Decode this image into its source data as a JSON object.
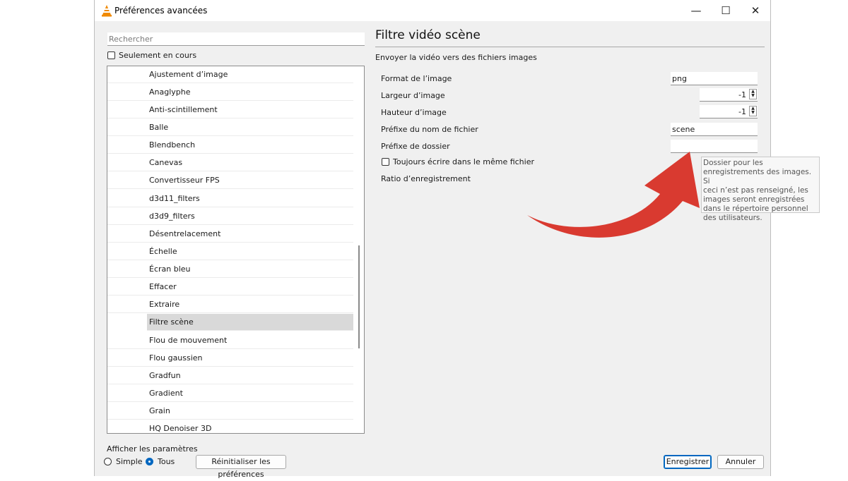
{
  "window": {
    "title": "Préférences avancées",
    "minimize": "—",
    "maximize": "☐",
    "close": "✕"
  },
  "search": {
    "placeholder": "Rechercher"
  },
  "filter": {
    "only_current_label": "Seulement en cours"
  },
  "tree": {
    "items": [
      "Ajustement d’image",
      "Anaglyphe",
      "Anti-scintillement",
      "Balle",
      "Blendbench",
      "Canevas",
      "Convertisseur FPS",
      "d3d11_filters",
      "d3d9_filters",
      "Désentrelacement",
      "Échelle",
      "Écran bleu",
      "Effacer",
      "Extraire",
      "Filtre scène",
      "Flou de mouvement",
      "Flou gaussien",
      "Gradfun",
      "Gradient",
      "Grain",
      "HQ Denoiser 3D"
    ],
    "selected": "Filtre scène"
  },
  "panel": {
    "title": "Filtre vidéo scène",
    "description": "Envoyer la vidéo vers des fichiers images",
    "format_label": "Format de l’image",
    "format_value": "png",
    "width_label": "Largeur d’image",
    "width_value": "-1",
    "height_label": "Hauteur d’image",
    "height_value": "-1",
    "prefix_label": "Préfixe du nom de fichier",
    "prefix_value": "scene",
    "folder_label": "Préfixe de dossier",
    "folder_value": "",
    "same_file_label": "Toujours écrire dans le même fichier",
    "ratio_label": "Ratio d’enregistrement"
  },
  "tooltip": {
    "lines": [
      "Dossier pour les",
      "enregistrements des images. Si",
      "ceci n’est pas renseigné, les",
      "images seront enregistrées",
      "dans le répertoire personnel",
      "des utilisateurs."
    ]
  },
  "footer": {
    "show_params_label": "Afficher les paramètres",
    "simple_label": "Simple",
    "all_label": "Tous",
    "selected_mode": "Tous",
    "reset_label": "Réinitialiser les préférences",
    "save_label": "Enregistrer",
    "cancel_label": "Annuler"
  },
  "colors": {
    "accent": "#0067c0",
    "arrow": "#d93a30",
    "selection": "#d9d9d9"
  },
  "icons": {
    "app": "vlc-cone-icon",
    "spin": "spinner-arrows-icon",
    "arrow": "red-curved-arrow-icon"
  }
}
